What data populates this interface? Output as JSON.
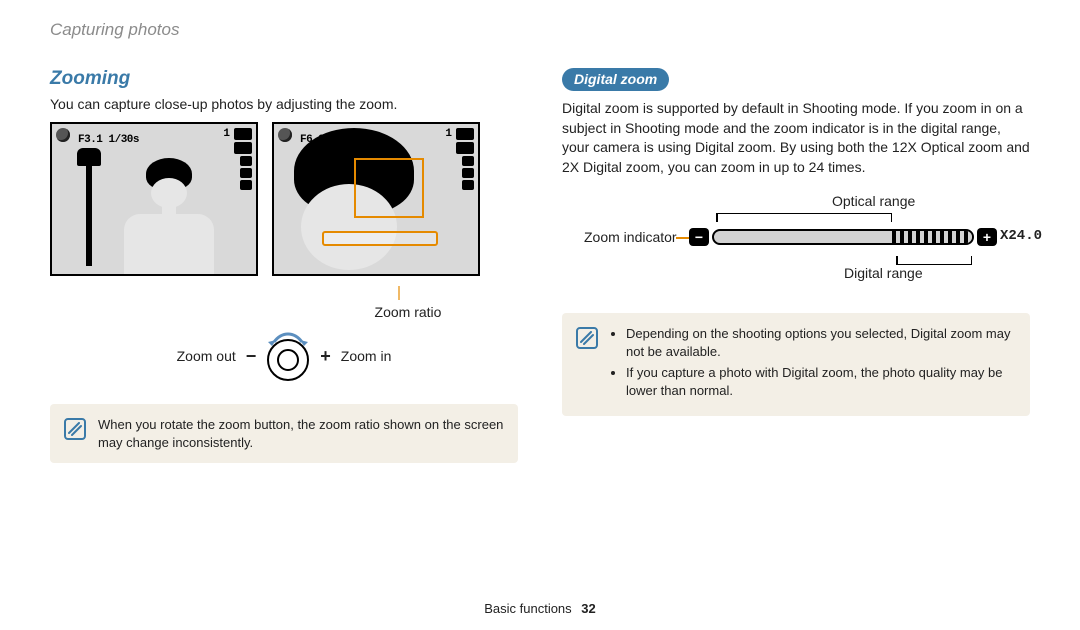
{
  "header": {
    "breadcrumb": "Capturing photos"
  },
  "footer": {
    "section": "Basic functions",
    "page": "32"
  },
  "left": {
    "title": "Zooming",
    "intro": "You can capture close-up photos by adjusting the zoom.",
    "screen1_info": "F3.1 1/30s",
    "screen2_info": "F6.3 1/45s",
    "osd_count": "1",
    "label_ratio": "Zoom ratio",
    "label_out": "Zoom out",
    "label_in": "Zoom in",
    "note": "When you rotate the zoom button, the zoom ratio shown on the screen may change inconsistently."
  },
  "right": {
    "pill": "Digital zoom",
    "para": "Digital zoom is supported by default in Shooting mode. If you zoom in on a subject in Shooting mode and the zoom indicator is in the digital range, your camera is using Digital zoom. By using both the 12X Optical zoom and 2X Digital zoom, you can zoom in up to 24 times.",
    "label_optical": "Optical range",
    "label_indicator": "Zoom indicator",
    "label_digital": "Digital range",
    "zoom_value": "X24.0",
    "notes": [
      "Depending on the shooting options you selected, Digital zoom may not be available.",
      "If you capture a photo with Digital zoom, the photo quality may be lower than normal."
    ]
  }
}
